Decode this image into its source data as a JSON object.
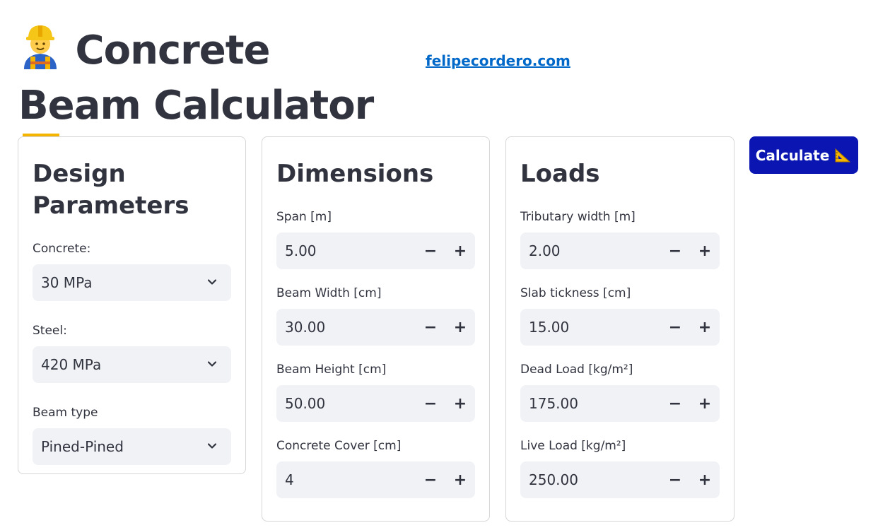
{
  "header": {
    "title": "Concrete Beam Calculator",
    "link_text": "felipecordero.com"
  },
  "design": {
    "title_line1": "Design",
    "title_line2": "Parameters",
    "concrete_label": "Concrete:",
    "concrete_value": "30 MPa",
    "steel_label": "Steel:",
    "steel_value": "420 MPa",
    "beam_type_label": "Beam type",
    "beam_type_value": "Pined-Pined"
  },
  "dimensions": {
    "title": "Dimensions",
    "fields": [
      {
        "label": "Span [m]",
        "value": "5.00"
      },
      {
        "label": "Beam Width [cm]",
        "value": "30.00"
      },
      {
        "label": "Beam Height [cm]",
        "value": "50.00"
      },
      {
        "label": "Concrete Cover [cm]",
        "value": "4"
      }
    ]
  },
  "loads": {
    "title": "Loads",
    "fields": [
      {
        "label": "Tributary width [m]",
        "value": "2.00"
      },
      {
        "label": "Slab tickness [cm]",
        "value": "15.00"
      },
      {
        "label": "Dead Load [kg/m²]",
        "value": "175.00"
      },
      {
        "label": "Live Load [kg/m²]",
        "value": "250.00"
      }
    ]
  },
  "stepper": {
    "minus": "−",
    "plus": "+"
  },
  "calculate_label": "Calculate",
  "colors": {
    "accent": "#0b16b2",
    "link": "#0068c9",
    "field_bg": "#f0f2f6"
  },
  "icons": [
    "construction-worker-icon",
    "building-construction-icon",
    "triangular-ruler-icon",
    "chevron-down-icon"
  ]
}
